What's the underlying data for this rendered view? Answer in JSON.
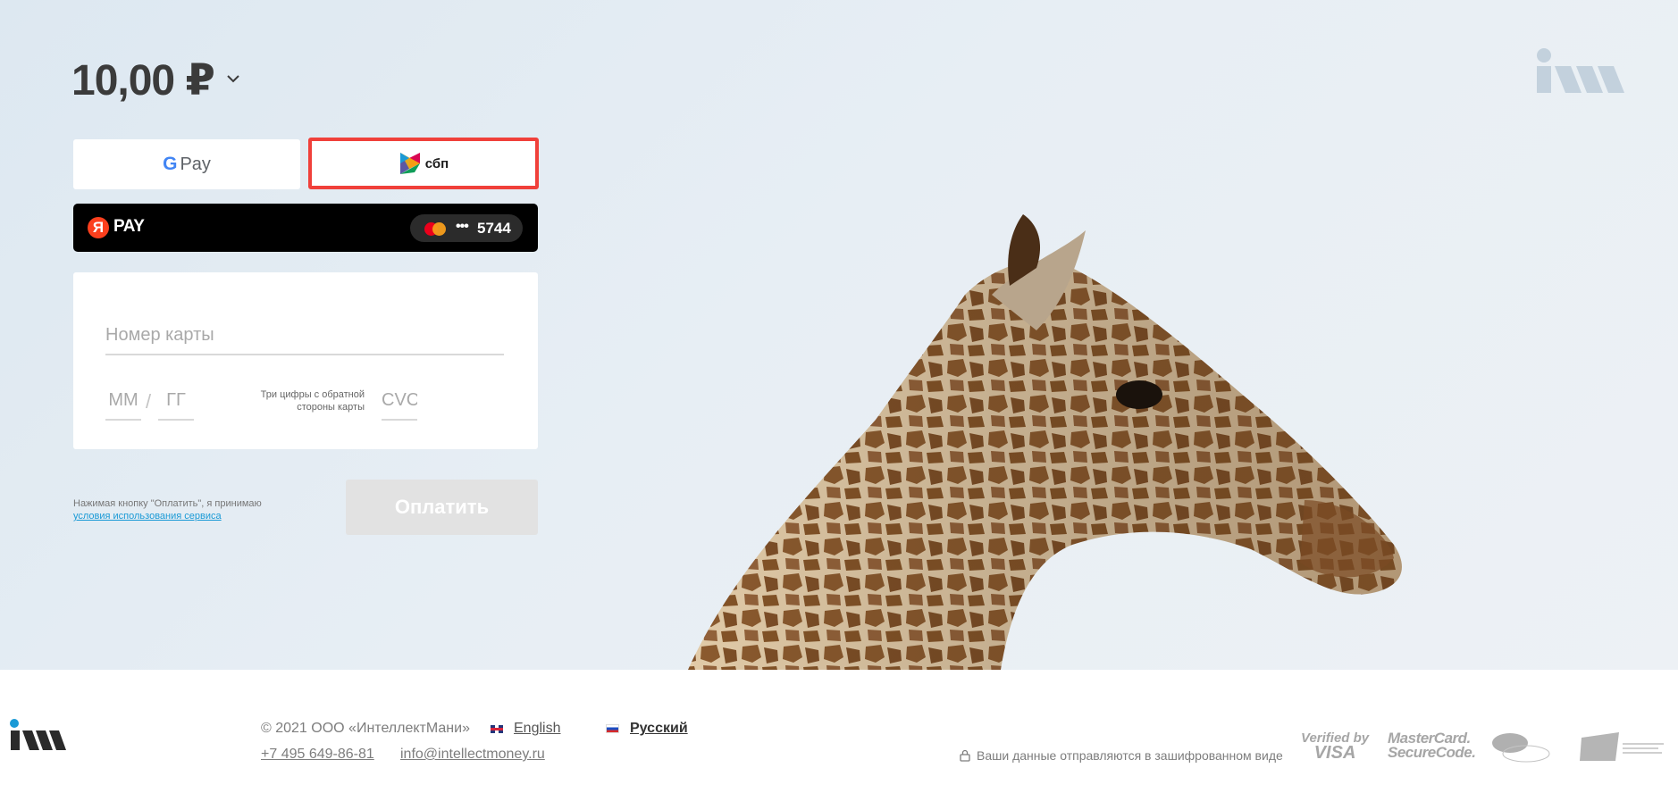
{
  "amount": {
    "value": "10,00 ₽"
  },
  "payment_methods": {
    "gpay_label": "Pay",
    "sbp_label": "сбп",
    "yandex_pay": {
      "logo_letter": "Я",
      "label": "PAY",
      "card_dots": "•••",
      "card_last4": "5744"
    }
  },
  "card_form": {
    "card_number_placeholder": "Номер карты",
    "mm_placeholder": "ММ",
    "slash": "/",
    "yy_placeholder": "ГГ",
    "cvc_hint": "Три цифры с обратной стороны карты",
    "cvc_placeholder": "CVC"
  },
  "terms": {
    "text": "Нажимая кнопку \"Оплатить\", я принимаю",
    "link": "условия использования сервиса"
  },
  "pay_button": {
    "label": "Оплатить"
  },
  "footer": {
    "copyright": "© 2021 ООО «ИнтеллектМани»",
    "lang_en": "English",
    "lang_ru": "Русский",
    "phone": "+7 495 649-86-81",
    "email": "info@intellectmoney.ru",
    "secure_text": "Ваши данные отправляются в зашифрованном виде",
    "badges": {
      "visa_top": "Verified by",
      "visa_bottom": "VISA",
      "mc_top": "MasterCard.",
      "mc_bottom": "SecureCode."
    }
  },
  "colors": {
    "sbp_highlight": "#f0403a",
    "yandex_red": "#fc3f1d",
    "link_blue": "#1a9ad6",
    "pay_button_disabled": "#e2e2e2"
  },
  "icons": [
    "chevron-down-icon",
    "google-g-icon",
    "sbp-logo-icon",
    "yandex-logo-icon",
    "mastercard-icon",
    "lock-icon",
    "brand-logo"
  ]
}
